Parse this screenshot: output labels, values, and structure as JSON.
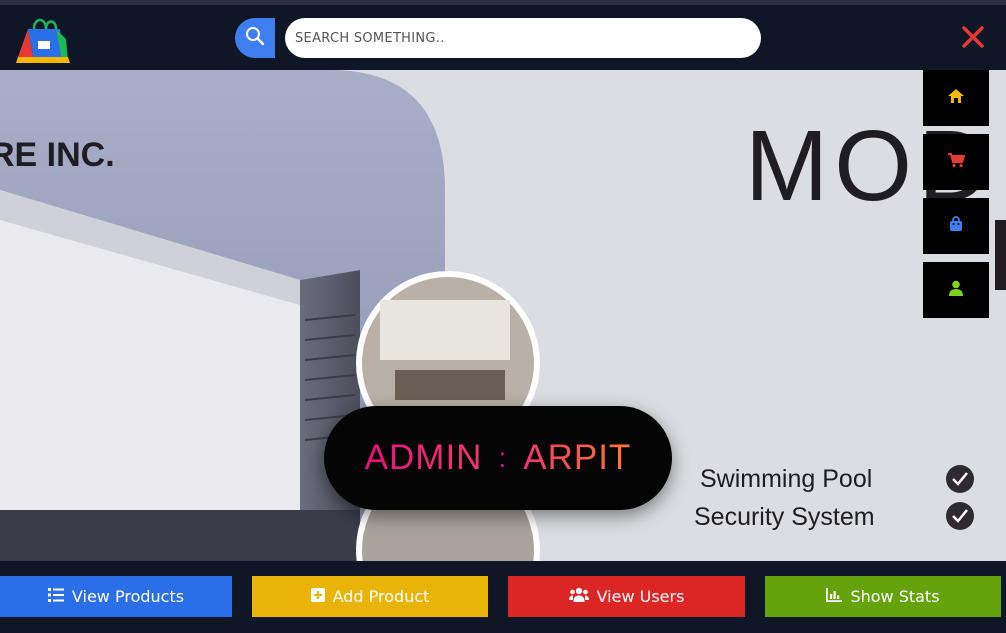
{
  "header": {
    "search": {
      "placeholder": "SEARCH SOMETHING.."
    }
  },
  "hero": {
    "banner_left_text": "RE INC.",
    "banner_right_text": "MOD",
    "features": [
      "Swimming Pool",
      "Security System"
    ]
  },
  "side_menu": {
    "items": [
      {
        "icon": "home-icon",
        "color": "#f5b800"
      },
      {
        "icon": "cart-icon",
        "color": "#e53935"
      },
      {
        "icon": "bag-icon",
        "color": "#3e7ff0"
      },
      {
        "icon": "user-icon",
        "color": "#7ed321"
      }
    ]
  },
  "admin": {
    "role": "ADMIN",
    "separator": ":",
    "name": "ARPIT"
  },
  "actions": {
    "view_products": "View Products",
    "add_product": "Add Product",
    "view_users": "View Users",
    "show_stats": "Show Stats"
  },
  "colors": {
    "blue": "#2a6ee8",
    "yellow": "#eab308",
    "red": "#dc2626",
    "green": "#65a30d"
  }
}
